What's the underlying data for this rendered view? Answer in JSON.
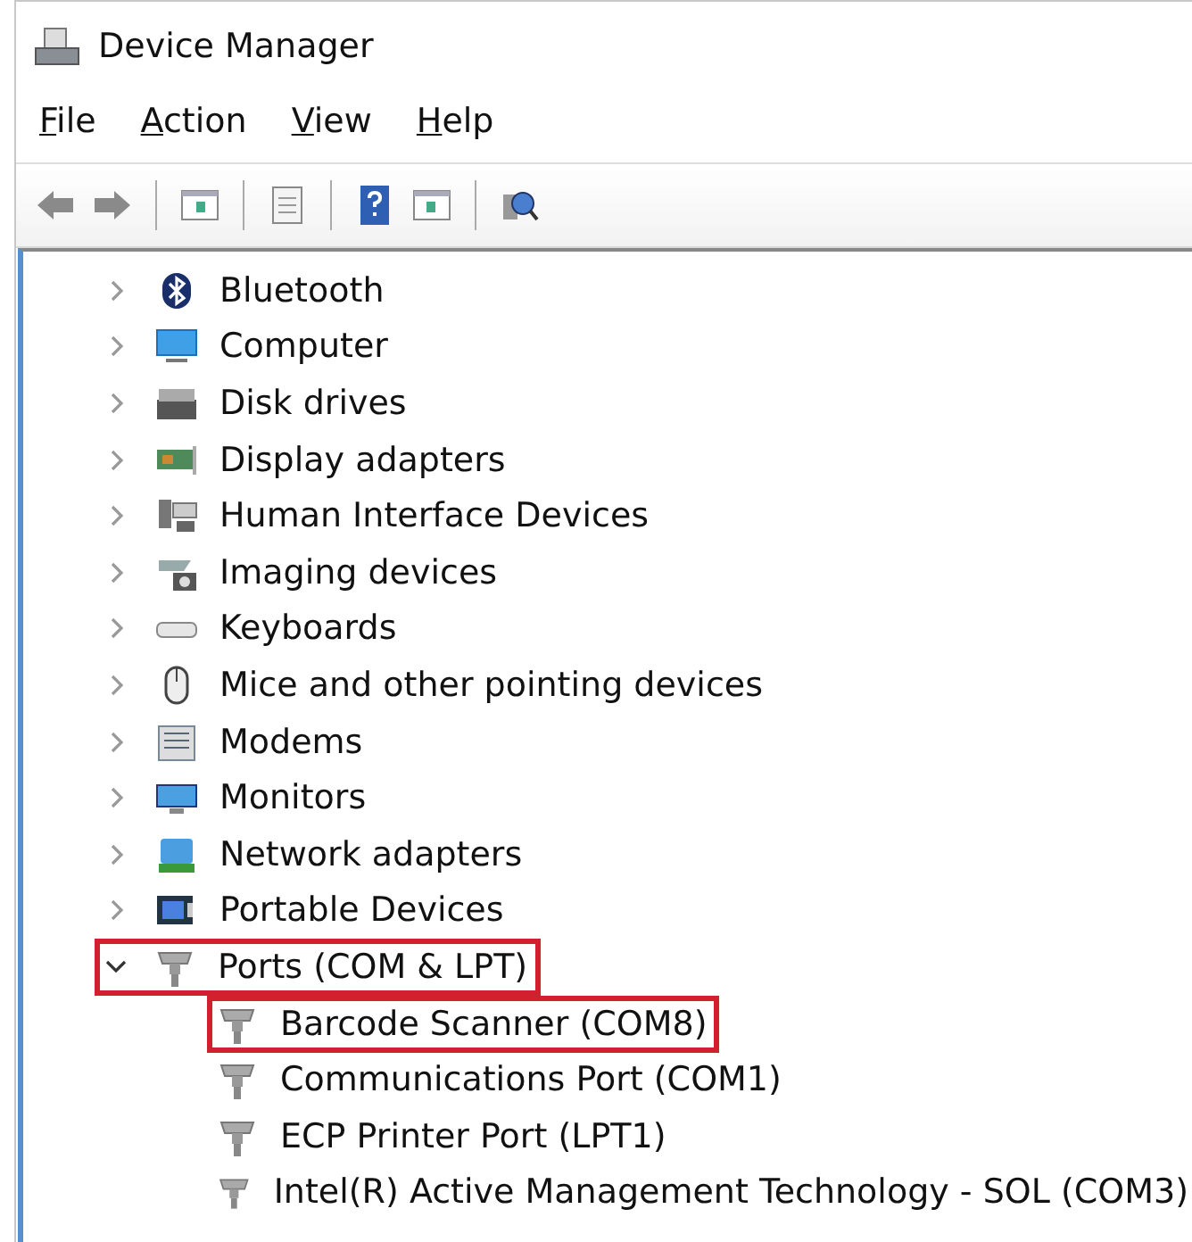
{
  "window": {
    "title": "Device Manager"
  },
  "menu": [
    {
      "label": "File"
    },
    {
      "label": "Action"
    },
    {
      "label": "View"
    },
    {
      "label": "Help"
    }
  ],
  "tree": [
    {
      "label": "Bluetooth",
      "expanded": false,
      "highlighted": false
    },
    {
      "label": "Computer",
      "expanded": false,
      "highlighted": false
    },
    {
      "label": "Disk drives",
      "expanded": false,
      "highlighted": false
    },
    {
      "label": "Display adapters",
      "expanded": false,
      "highlighted": false
    },
    {
      "label": "Human Interface Devices",
      "expanded": false,
      "highlighted": false
    },
    {
      "label": "Imaging devices",
      "expanded": false,
      "highlighted": false
    },
    {
      "label": "Keyboards",
      "expanded": false,
      "highlighted": false
    },
    {
      "label": "Mice and other pointing devices",
      "expanded": false,
      "highlighted": false
    },
    {
      "label": "Modems",
      "expanded": false,
      "highlighted": false
    },
    {
      "label": "Monitors",
      "expanded": false,
      "highlighted": false
    },
    {
      "label": "Network adapters",
      "expanded": false,
      "highlighted": false
    },
    {
      "label": "Portable Devices",
      "expanded": false,
      "highlighted": false
    },
    {
      "label": "Ports (COM & LPT)",
      "expanded": true,
      "highlighted": true,
      "children": [
        {
          "label": "Barcode Scanner (COM8)",
          "highlighted": true
        },
        {
          "label": "Communications Port (COM1)",
          "highlighted": false
        },
        {
          "label": "ECP Printer Port (LPT1)",
          "highlighted": false
        },
        {
          "label": "Intel(R) Active Management Technology - SOL (COM3)",
          "highlighted": false
        }
      ]
    }
  ]
}
